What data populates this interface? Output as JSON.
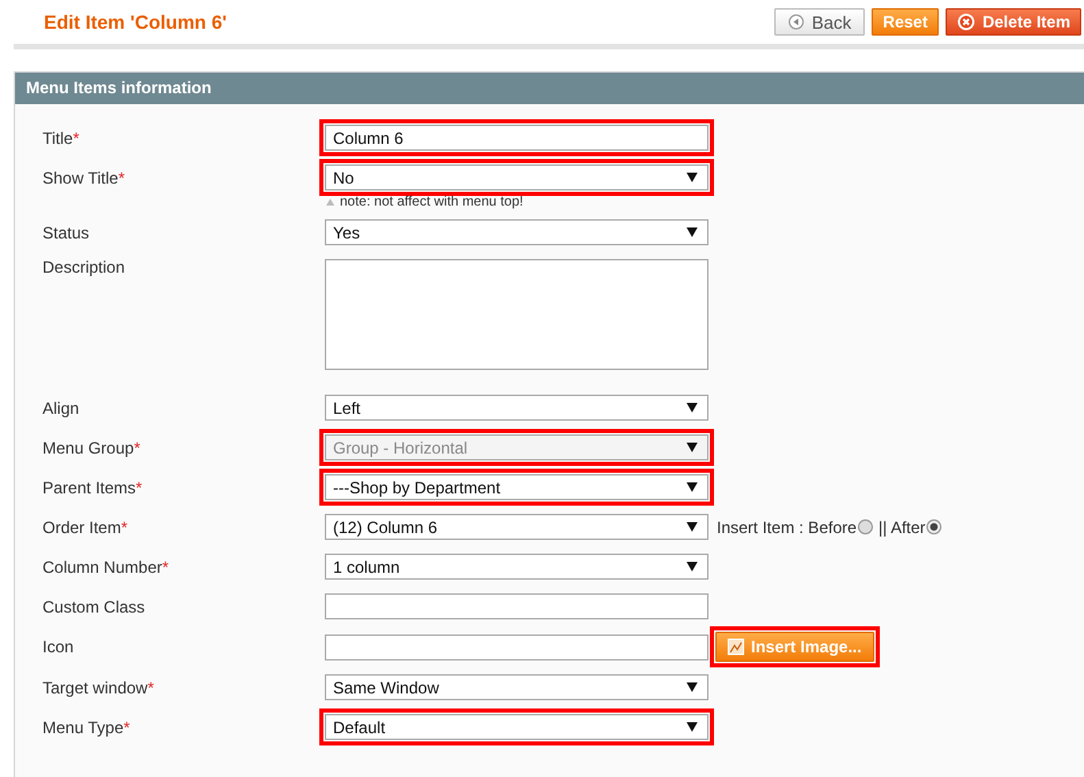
{
  "page_title": "Edit Item 'Column 6'",
  "buttons": [
    {
      "label": "Back",
      "kind": "back"
    },
    {
      "label": "Reset",
      "kind": "reset"
    },
    {
      "label": "Delete Item",
      "kind": "delete"
    }
  ],
  "section": {
    "title": "Menu Items information"
  },
  "fields": [
    {
      "label": "Title",
      "required_mark": "*",
      "kind": "text",
      "value": "Column 6",
      "highlighted": true
    },
    {
      "label": "Show Title",
      "required_mark": "*",
      "kind": "select",
      "value": "No",
      "disabled": false,
      "highlighted": true,
      "note": "note: not affect with menu top!"
    },
    {
      "label": "Status",
      "kind": "select",
      "value": "Yes",
      "disabled": false,
      "highlighted": false
    },
    {
      "label": "Description",
      "kind": "textarea",
      "highlighted": false
    },
    {
      "label": "Align",
      "kind": "select",
      "value": "Left",
      "disabled": false,
      "highlighted": false
    },
    {
      "label": "Menu Group",
      "required_mark": "*",
      "kind": "select",
      "value": "Group - Horizontal",
      "disabled": true,
      "highlighted": true
    },
    {
      "label": "Parent Items",
      "required_mark": "*",
      "kind": "select",
      "value": "---Shop by Department",
      "disabled": false,
      "highlighted": true
    },
    {
      "label": "Order Item",
      "required_mark": "*",
      "kind": "select",
      "value": "(12) Column 6",
      "disabled": false,
      "highlighted": false,
      "radios": [
        {
          "label": "Insert Item : Before",
          "selected": false
        },
        {
          "label": "|| After",
          "selected": true
        }
      ]
    },
    {
      "label": "Column Number",
      "required_mark": "*",
      "kind": "select",
      "value": "1 column",
      "disabled": false,
      "highlighted": false
    },
    {
      "label": "Custom Class",
      "kind": "text",
      "highlighted": false
    },
    {
      "label": "Icon",
      "kind": "text",
      "highlighted": false,
      "button": {
        "label": "Insert Image...",
        "highlighted": true
      }
    },
    {
      "label": "Target window",
      "required_mark": "*",
      "kind": "select",
      "value": "Same Window",
      "disabled": false,
      "highlighted": false
    },
    {
      "label": "Menu Type",
      "required_mark": "*",
      "kind": "select",
      "value": "Default",
      "disabled": false,
      "highlighted": true
    }
  ]
}
